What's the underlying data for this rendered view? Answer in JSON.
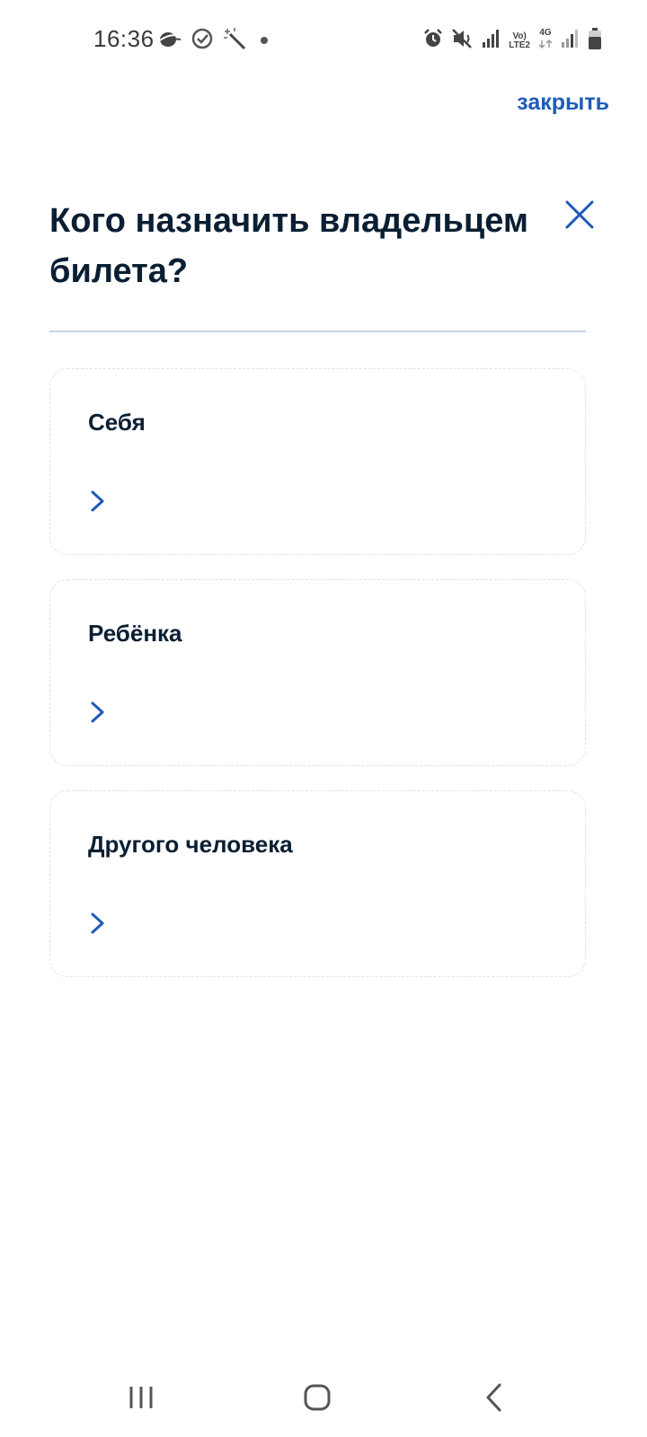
{
  "status_bar": {
    "time": "16:36",
    "network_label_top": "Vo)",
    "network_label_bottom": "LTE2",
    "network_type": "4G",
    "left_icons": [
      "weather-icon",
      "check-circle-icon",
      "magic-wand-icon",
      "dot-icon"
    ],
    "right_icons": [
      "alarm-icon",
      "mute-icon",
      "signal-icon",
      "volte-icon",
      "4g-icon",
      "signal-icon-2",
      "battery-icon"
    ]
  },
  "header": {
    "close_link": "закрыть"
  },
  "page": {
    "title": "Кого назначить владельцем билета?"
  },
  "options": [
    {
      "label": "Себя"
    },
    {
      "label": "Ребёнка"
    },
    {
      "label": "Другого человека"
    }
  ],
  "colors": {
    "accent": "#1e5bb8",
    "text": "#0b1f33",
    "divider": "#c7d2e6"
  }
}
